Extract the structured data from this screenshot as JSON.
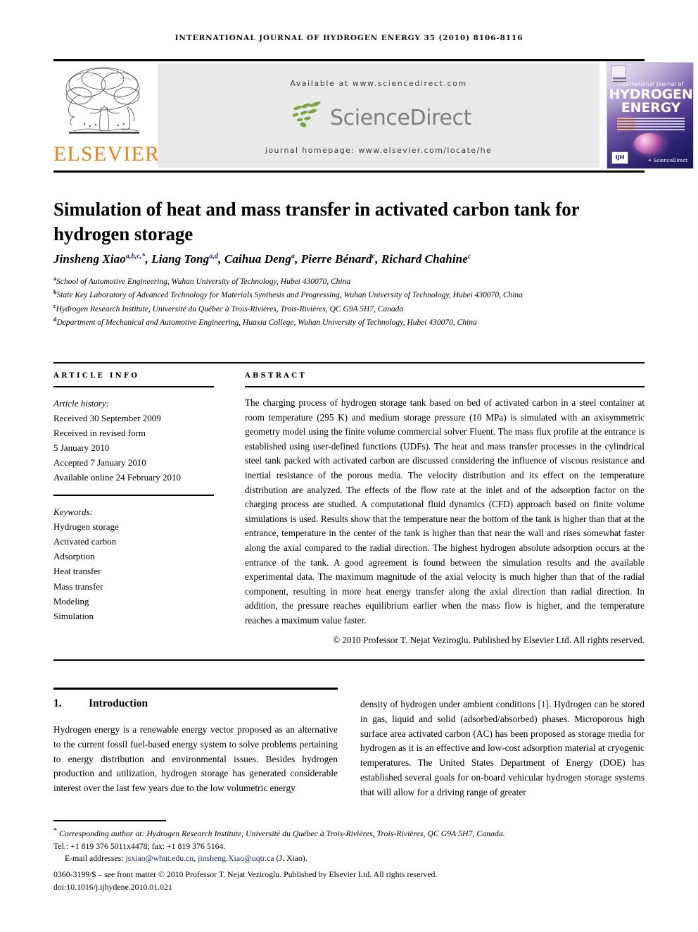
{
  "running_head": "INTERNATIONAL JOURNAL OF HYDROGEN ENERGY 35 (2010) 8106-8116",
  "masthead": {
    "available_at": "Available at www.sciencedirect.com",
    "sciencedirect_wordmark": "ScienceDirect",
    "journal_homepage": "journal homepage: www.elsevier.com/locate/he",
    "publisher_name": "ELSEVIER",
    "publisher_color": "#F07E13",
    "sciencedirect_leaf_color": "#7AA542",
    "sciencedirect_text_color": "#7E7E7E",
    "band_background": "#E9E9E9"
  },
  "cover": {
    "line_small": "International Journal of",
    "line_big_1": "HYDROGEN",
    "line_big_2": "ENERGY",
    "badge": "IJH",
    "sciencedirect": "ScienceDirect"
  },
  "title": "Simulation of heat and mass transfer in activated carbon tank for hydrogen storage",
  "authors_html": "Jinsheng Xiao<sup>a,b,c,</sup><sup>*</sup>, Liang Tong<sup>a,d</sup>, Caihua Deng<sup>a</sup>, Pierre Bénard<sup>c</sup>, Richard Chahine<sup>c</sup>",
  "affiliations": [
    {
      "mark": "a",
      "text": "School of Automotive Engineering, Wuhan University of Technology, Hubei 430070, China"
    },
    {
      "mark": "b",
      "text": "State Key Laboratory of Advanced Technology for Materials Synthesis and Progressing, Wuhan University of Technology, Hubei 430070, China"
    },
    {
      "mark": "c",
      "text": "Hydrogen Research Institute, Université du Québec à Trois-Rivières, Trois-Rivières, QC G9A 5H7, Canada"
    },
    {
      "mark": "d",
      "text": "Department of Mechanical and Automotive Engineering, Huaxia College, Wuhan University of Technology, Hubei 430070, China"
    }
  ],
  "article_info": {
    "heading": "ARTICLE INFO",
    "history_label": "Article history:",
    "history": [
      "Received 30 September 2009",
      "Received in revised form",
      "5 January 2010",
      "Accepted 7 January 2010",
      "Available online 24 February 2010"
    ],
    "keywords_label": "Keywords:",
    "keywords": [
      "Hydrogen storage",
      "Activated carbon",
      "Adsorption",
      "Heat transfer",
      "Mass transfer",
      "Modeling",
      "Simulation"
    ]
  },
  "abstract": {
    "heading": "ABSTRACT",
    "text": "The charging process of hydrogen storage tank based on bed of activated carbon in a steel container at room temperature (295 K) and medium storage pressure (10 MPa) is simulated with an axisymmetric geometry model using the finite volume commercial solver Fluent. The mass flux profile at the entrance is established using user-defined functions (UDFs). The heat and mass transfer processes in the cylindrical steel tank packed with activated carbon are discussed considering the influence of viscous resistance and inertial resistance of the porous media. The velocity distribution and its effect on the temperature distribution are analyzed. The effects of the flow rate at the inlet and of the adsorption factor on the charging process are studied. A computational fluid dynamics (CFD) approach based on finite volume simulations is used. Results show that the temperature near the bottom of the tank is higher than that at the entrance, temperature in the center of the tank is higher than that near the wall and rises somewhat faster along the axial compared to the radial direction. The highest hydrogen absolute adsorption occurs at the entrance of the tank. A good agreement is found between the simulation results and the available experimental data. The maximum magnitude of the axial velocity is much higher than that of the radial component, resulting in more heat energy transfer along the axial direction than radial direction. In addition, the pressure reaches equilibrium earlier when the mass flow is higher, and the temperature reaches a maximum value faster.",
    "copyright": "© 2010 Professor T. Nejat Veziroglu. Published by Elsevier Ltd. All rights reserved."
  },
  "section": {
    "number": "1.",
    "title": "Introduction",
    "left_paragraph": "Hydrogen energy is a renewable energy vector proposed as an alternative to the current fossil fuel-based energy system to solve problems pertaining to energy distribution and environmental issues. Besides hydrogen production and utilization, hydrogen storage has generated considerable interest over the last few years due to the low volumetric energy",
    "right_before_cite": "density of hydrogen under ambient conditions ",
    "right_cite": "[1]",
    "right_after_cite": ". Hydrogen can be stored in gas, liquid and solid (adsorbed/absorbed) phases. Microporous high surface area activated carbon (AC) has been proposed as storage media for hydrogen as it is an effective and low-cost adsorption material at cryogenic temperatures. The United States Department of Energy (DOE) has established several goals for on-board vehicular hydrogen storage systems that will allow for a driving range of greater"
  },
  "footnote": {
    "corresponding_line": "Corresponding author at: Hydrogen Research Institute, Université du Québec à Trois-Rivières, Trois-Rivières, QC G9A 5H7, Canada.",
    "tel_line": "Tel.: +1 819 376 5011x4478; fax: +1 819 376 5164.",
    "email_label": "E-mail addresses:",
    "email_1": "jsxiao@whut.edu.cn",
    "email_sep": ", ",
    "email_2": "jinsheng.Xiao@uqtr.ca",
    "email_suffix": " (J. Xiao).",
    "front_matter": "0360-3199/$ – see front matter © 2010 Professor T. Nejat Veziroglu. Published by Elsevier Ltd. All rights reserved.",
    "doi": "doi:10.1016/j.ijhydene.2010.01.021"
  }
}
